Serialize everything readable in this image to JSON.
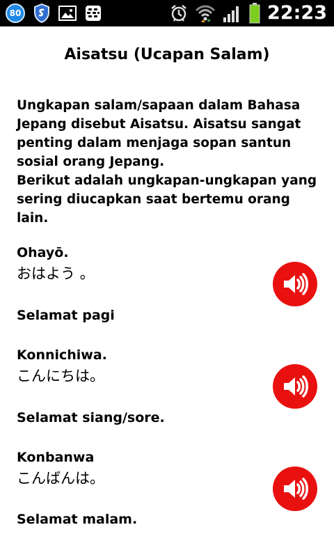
{
  "status_bar": {
    "notification_count": "80",
    "time": "22:23",
    "icons": [
      "avast-shield-icon",
      "gallery-icon",
      "bbm-icon",
      "alarm-icon",
      "wifi-icon",
      "signal-icon",
      "battery-icon"
    ]
  },
  "page": {
    "title": "Aisatsu (Ucapan Salam)",
    "intro_lines": [
      "Ungkapan salam/sapaan dalam Bahasa",
      "Jepang disebut Aisatsu. Aisatsu sangat",
      "penting dalam menjaga sopan santun",
      "sosial orang Jepang.",
      "Berikut adalah ungkapan-ungkapan yang",
      "sering diucapkan saat bertemu orang",
      "lain."
    ]
  },
  "phrases": [
    {
      "romaji": "Ohayō.",
      "kana": "おはよう 。",
      "meaning": "Selamat pagi"
    },
    {
      "romaji": "Konnichiwa.",
      "kana": "こんにちは。",
      "meaning": "Selamat siang/sore."
    },
    {
      "romaji": "Konbanwa",
      "kana": "こんばんは。",
      "meaning": "Selamat malam."
    }
  ],
  "colors": {
    "speaker_button": "#e8110f",
    "status_bar_bg": "#000000",
    "battery": "#7ccd1f"
  }
}
